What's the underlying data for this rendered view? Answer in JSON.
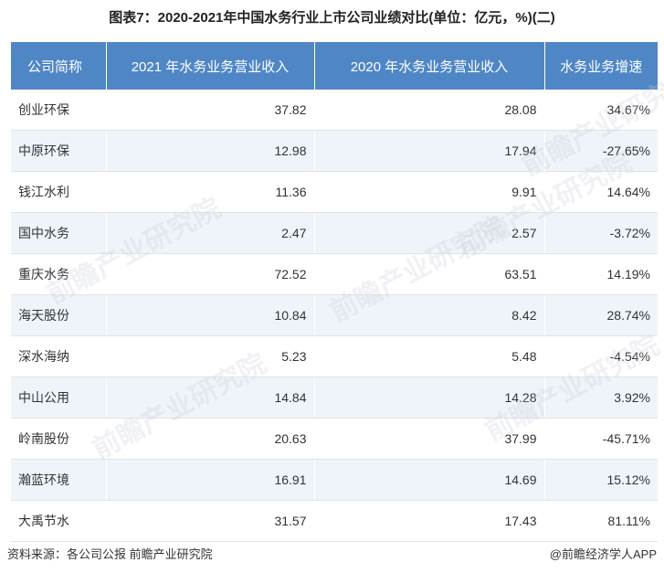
{
  "title": "图表7：2020-2021年中国水务行业上市公司业绩对比(单位：亿元，%)(二)",
  "chart_data": {
    "type": "table",
    "columns": [
      "公司简称",
      "2021 年水务业务营业收入",
      "2020 年水务业务营业收入",
      "水务业务增速"
    ],
    "rows": [
      [
        "创业环保",
        "37.82",
        "28.08",
        "34.67%"
      ],
      [
        "中原环保",
        "12.98",
        "17.94",
        "-27.65%"
      ],
      [
        "钱江水利",
        "11.36",
        "9.91",
        "14.64%"
      ],
      [
        "国中水务",
        "2.47",
        "2.57",
        "-3.72%"
      ],
      [
        "重庆水务",
        "72.52",
        "63.51",
        "14.19%"
      ],
      [
        "海天股份",
        "10.84",
        "8.42",
        "28.74%"
      ],
      [
        "深水海纳",
        "5.23",
        "5.48",
        "-4.54%"
      ],
      [
        "中山公用",
        "14.84",
        "14.28",
        "3.92%"
      ],
      [
        "岭南股份",
        "20.63",
        "37.99",
        "-45.71%"
      ],
      [
        "瀚蓝环境",
        "16.91",
        "14.69",
        "15.12%"
      ],
      [
        "大禹节水",
        "31.57",
        "17.43",
        "81.11%"
      ]
    ]
  },
  "footer": {
    "source": "资料来源：各公司公报 前瞻产业研究院",
    "brand": "@前瞻经济学人APP"
  },
  "watermark": "前瞻产业研究院",
  "colors": {
    "header_bg": "#4f86c6",
    "row_alt": "#eff4fa"
  }
}
